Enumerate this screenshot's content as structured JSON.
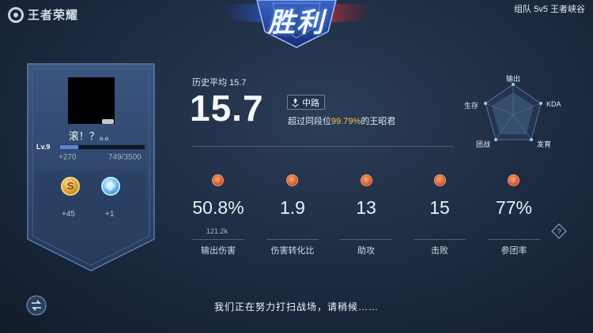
{
  "header": {
    "logo_text": "王者荣耀",
    "mode": "组队 5v5 王者峡谷",
    "result": "胜利"
  },
  "player": {
    "name": "滚！？。。",
    "level": "Lv.9",
    "xp_gain": "+270",
    "xp_total": "749/3500",
    "xp_fraction": 0.214,
    "gold_reward": "+45",
    "gem_reward": "+1"
  },
  "score": {
    "avg_label": "历史平均 15.7",
    "value": "15.7",
    "lane": "中路",
    "percentile_prefix": "超过同段位",
    "percentile_value": "99.79%",
    "percentile_suffix": "的王昭君"
  },
  "radar": {
    "labels": {
      "output": "输出",
      "kda": "KDA",
      "develop": "发育",
      "teamfight": "团战",
      "survive": "生存"
    }
  },
  "stats": [
    {
      "value": "50.8%",
      "sub": "121.2k",
      "label": "输出伤害",
      "icon": "damage-icon"
    },
    {
      "value": "1.9",
      "sub": "",
      "label": "伤害转化比",
      "icon": "conversion-icon"
    },
    {
      "value": "13",
      "sub": "",
      "label": "助攻",
      "icon": "assist-icon"
    },
    {
      "value": "15",
      "sub": "",
      "label": "击败",
      "icon": "kill-icon"
    },
    {
      "value": "77%",
      "sub": "",
      "label": "参团率",
      "icon": "flag-icon"
    }
  ],
  "footer": {
    "loading": "我们正在努力打扫战场，请稍候……"
  },
  "colors": {
    "accent_yellow": "#f5c643",
    "stat_icon": "#d7502a",
    "xp_bar": "#5b86d6"
  }
}
